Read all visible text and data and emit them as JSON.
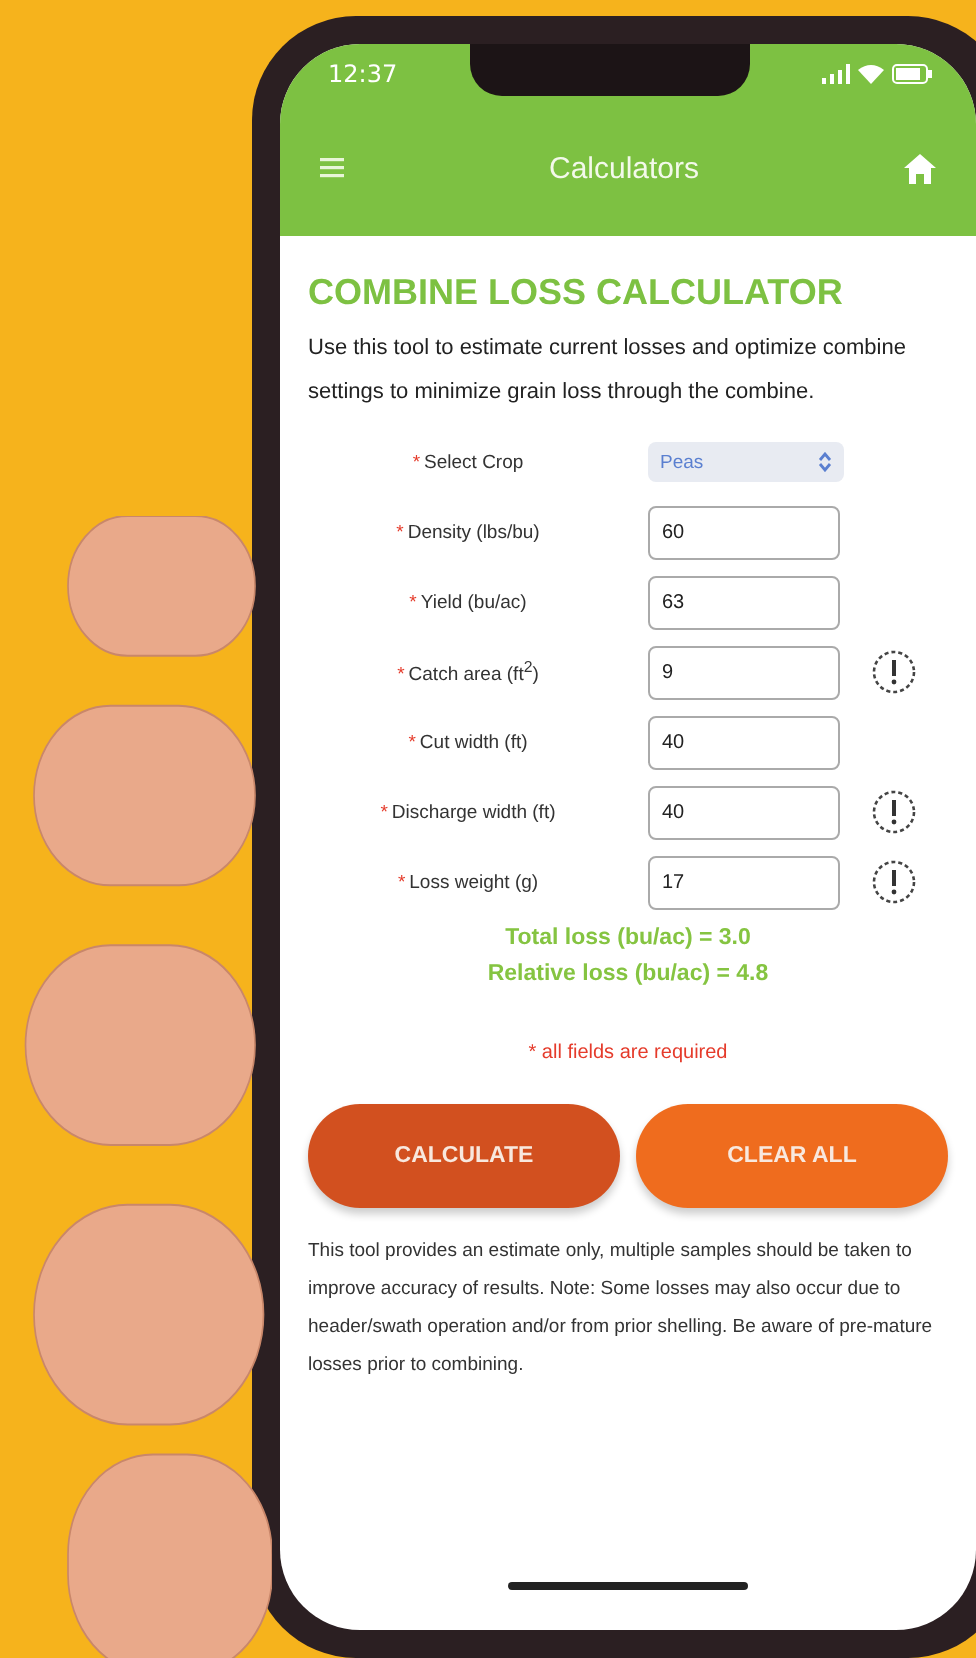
{
  "status_bar": {
    "time": "12:37"
  },
  "header": {
    "title": "Calculators"
  },
  "calculator": {
    "title": "COMBINE LOSS CALCULATOR",
    "intro": "Use this tool to estimate current losses and optimize combine settings to minimize grain loss through the combine.",
    "fields": [
      {
        "kind": "select",
        "marker": "*",
        "label": "Select Crop",
        "value": "Peas",
        "info": false
      },
      {
        "kind": "input",
        "marker": "*",
        "label": "Density (lbs/bu)",
        "value": "60",
        "info": false
      },
      {
        "kind": "input",
        "marker": "*",
        "label": "Yield (bu/ac)",
        "value": "63",
        "info": false
      },
      {
        "kind": "input",
        "marker": "*",
        "label": "Catch area (ft$^{2}$)",
        "value": "9",
        "info": true
      },
      {
        "kind": "input",
        "marker": "*",
        "label": "Cut width (ft)",
        "value": "40",
        "info": false
      },
      {
        "kind": "input",
        "marker": "*",
        "label": "Discharge width (ft)",
        "value": "40",
        "info": true
      },
      {
        "kind": "input",
        "marker": "*",
        "label": "Loss weight (g)",
        "value": "17",
        "info": true
      }
    ],
    "results": [
      "Total loss (bu/ac) = 3.0",
      "Relative loss (bu/ac) = 4.8"
    ],
    "required_note": "* all fields are required",
    "buttons": [
      {
        "kind": "primary",
        "label": "CALCULATE"
      },
      {
        "kind": "secondary",
        "label": "CLEAR ALL"
      }
    ],
    "disclaimer": "This tool provides an estimate only, multiple samples should be taken to improve accuracy of results. Note: Some losses may also occur due to header/swath operation and/or from prior shelling. Be aware of pre-mature losses prior to combining."
  }
}
